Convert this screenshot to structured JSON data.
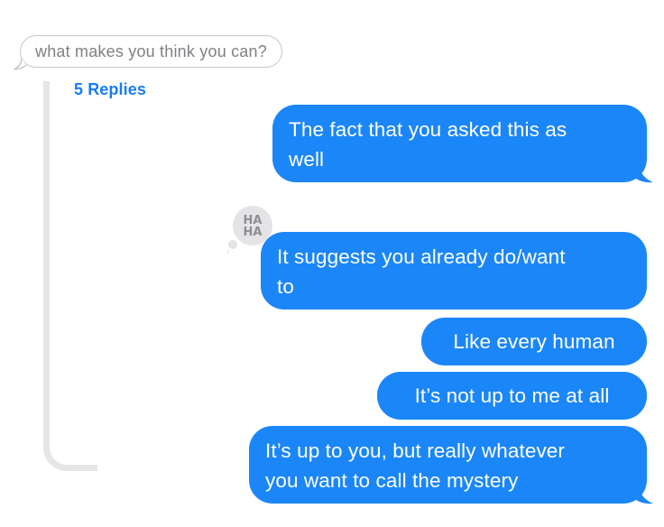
{
  "thread": {
    "quoted_message": "what makes you think you can?",
    "replies_label": "5 Replies"
  },
  "messages": [
    {
      "text": "The fact that you asked this as well",
      "line1": "The fact that you asked this as",
      "line2": "well",
      "tail": true
    },
    {
      "text": "It suggests you already do/want to",
      "line1": "It suggests you already do/want",
      "line2": "to",
      "tail": false,
      "tapback": "haha"
    },
    {
      "text": "Like every human",
      "tail": false
    },
    {
      "text": "It’s not up to me at all",
      "tail": false
    },
    {
      "text": "It’s up to you, but really whatever you want to call the mystery",
      "line1": "It’s up to you, but really whatever",
      "line2": "you want to call the mystery",
      "tail": true
    }
  ],
  "tapback": {
    "icon": "haha-tapback-icon",
    "top_text": "HA",
    "bottom_text": "HA"
  },
  "colors": {
    "bubble_blue": "#1b86f8",
    "link_blue": "#1a7cf5",
    "thread_line": "#e6e6e8",
    "quoted_border": "#c7c7cc",
    "quoted_text": "#808085"
  }
}
